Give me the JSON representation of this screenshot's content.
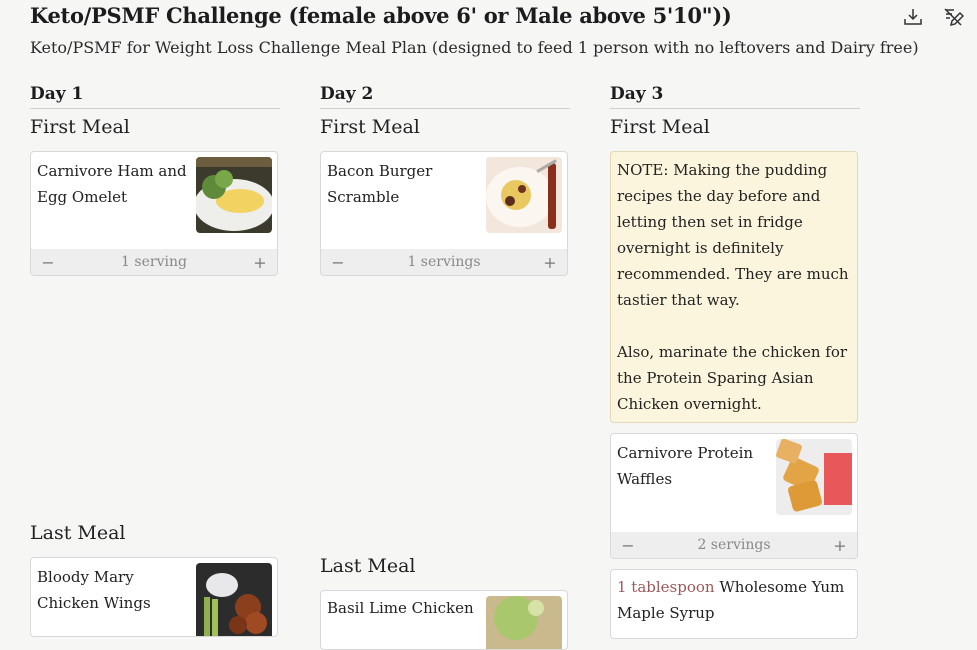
{
  "page": {
    "title": "Keto/PSMF Challenge (female above 6' or Male above 5'10\"))",
    "subtitle": "Keto/PSMF for Weight Loss Challenge Meal Plan (designed to feed 1 person with no leftovers and Dairy free)"
  },
  "toolbar": {
    "icons": [
      "download-icon",
      "edit-off-icon"
    ]
  },
  "days": [
    {
      "label": "Day 1",
      "first_meal_label": "First Meal",
      "last_meal_label": "Last Meal",
      "first_meal_recipe": {
        "name": "Carnivore Ham and Egg Omelet",
        "servings": "1 serving"
      },
      "last_meal_recipe": {
        "name": "Bloody Mary Chicken Wings"
      }
    },
    {
      "label": "Day 2",
      "first_meal_label": "First Meal",
      "last_meal_label": "Last Meal",
      "first_meal_recipe": {
        "name": "Bacon Burger Scramble",
        "servings": "1 servings"
      },
      "last_meal_recipe": {
        "name": "Basil Lime Chicken"
      }
    },
    {
      "label": "Day 3",
      "first_meal_label": "First Meal",
      "note_p1": "NOTE: Making the pudding recipes the day before and letting then set in fridge overnight is definitely recommended. They are much tastier that way.",
      "note_p2": "Also, marinate the chicken for the Protein Sparing Asian Chicken overnight.",
      "recipe": {
        "name": "Carnivore Protein Waffles",
        "servings": "2 servings"
      },
      "ingredient": {
        "quantity": "1 tablespoon",
        "name": "Wholesome Yum Maple Syrup"
      }
    }
  ],
  "controls": {
    "minus": "−",
    "plus": "+"
  }
}
